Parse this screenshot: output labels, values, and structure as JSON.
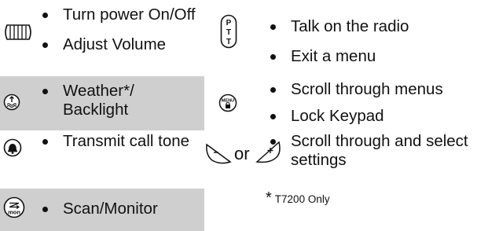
{
  "rows": [
    {
      "left": {
        "icon": "power-volume-knob-icon",
        "items": [
          "Turn power On/Off",
          "Adjust Volume"
        ]
      },
      "right": {
        "icon": "ptt-button-icon",
        "icon_text": [
          "P",
          "T",
          "T"
        ],
        "items": [
          "Talk on the radio",
          "Exit a menu"
        ]
      }
    },
    {
      "left": {
        "icon": "weather-backlight-button-icon",
        "items": [
          "Weather*/ Backlight"
        ]
      },
      "right": {
        "icon": "menu-lock-button-icon",
        "icon_text": [
          "MENU"
        ],
        "items": [
          "Scroll through menus",
          "Lock Keypad"
        ]
      }
    },
    {
      "left": {
        "icon": "call-tone-bell-icon",
        "items": [
          "Transmit call tone"
        ]
      },
      "right": {
        "icon": "minus-plus-buttons-icon",
        "or_text": "or",
        "items": [
          "Scroll through and select settings"
        ]
      }
    },
    {
      "left": {
        "icon": "scan-monitor-button-icon",
        "icon_text": [
          "mon"
        ],
        "items": [
          "Scan/Monitor"
        ]
      },
      "right": {
        "footnote_mark": "*",
        "footnote": "T7200 Only"
      }
    }
  ],
  "colors": {
    "shade": "#cfcfcf",
    "ink": "#111111"
  }
}
